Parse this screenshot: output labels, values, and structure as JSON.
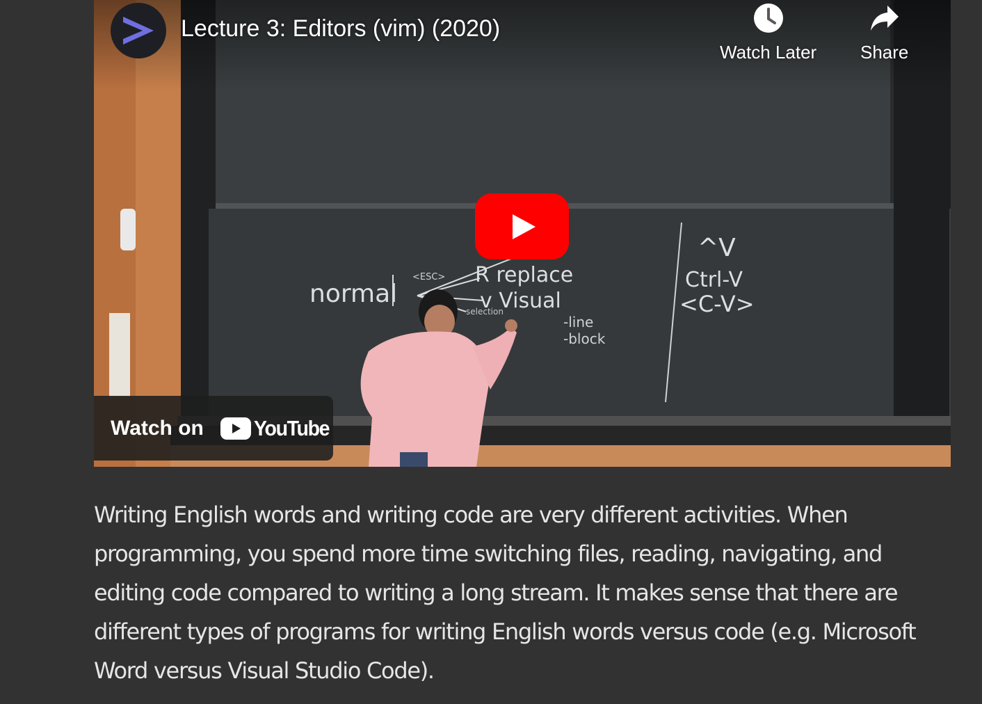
{
  "video": {
    "title": "Lecture 3: Editors (vim) (2020)",
    "watch_later_label": "Watch Later",
    "share_label": "Share",
    "watch_on_label": "Watch on",
    "youtube_wordmark": "YouTube",
    "icons": {
      "channel": "channel-avatar-arrow-icon",
      "watch_later": "clock-icon",
      "share": "share-arrow-icon",
      "play": "play-icon"
    },
    "colors": {
      "play_button": "#ff0000",
      "channel_arrow": "#6f6fe0"
    },
    "blackboard_text": {
      "normal": "normal",
      "esc": "<ESC>",
      "replace": "R replace",
      "visual": "v Visual",
      "selection": "selection",
      "line": "-line",
      "block": "-block",
      "caret_v": "^V",
      "ctrl_v": "Ctrl-V",
      "c_v": "<C-V>"
    }
  },
  "article": {
    "paragraph": "Writing English words and writing code are very different activities. When programming, you spend more time switching files, reading, navigating, and editing code compared to writing a long stream. It makes sense that there are different types of programs for writing English words versus code (e.g. Microsoft Word versus Visual Studio Code)."
  }
}
